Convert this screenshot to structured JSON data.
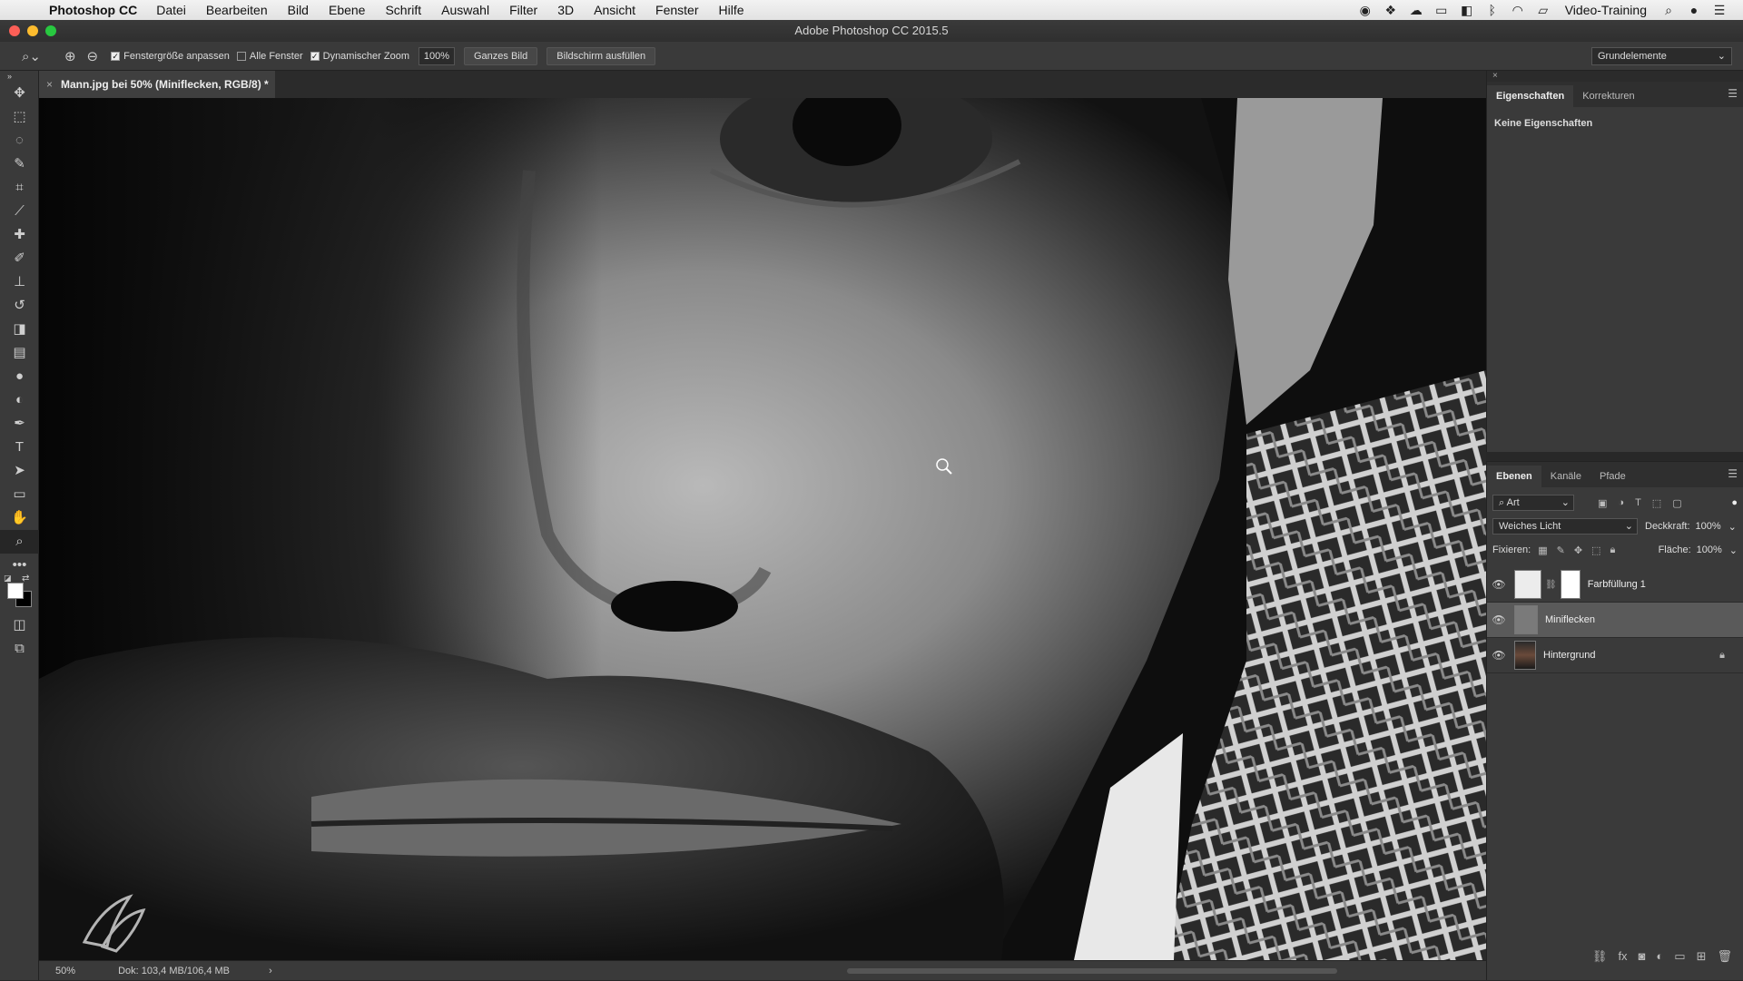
{
  "mac_menubar": {
    "app": "Photoshop CC",
    "items": [
      "Datei",
      "Bearbeiten",
      "Bild",
      "Ebene",
      "Schrift",
      "Auswahl",
      "Filter",
      "3D",
      "Ansicht",
      "Fenster",
      "Hilfe"
    ],
    "user": "Video-Training"
  },
  "window": {
    "title": "Adobe Photoshop CC 2015.5"
  },
  "options_bar": {
    "fit_window": "Fenstergröße anpassen",
    "all_windows": "Alle Fenster",
    "scrubby_zoom": "Dynamischer Zoom",
    "zoom_value": "100%",
    "fit_screen": "Ganzes Bild",
    "fill_screen": "Bildschirm ausfüllen",
    "workspace": "Grundelemente"
  },
  "document": {
    "tab_title": "Mann.jpg bei 50% (Miniflecken, RGB/8) *",
    "zoom": "50%",
    "doc_size": "Dok: 103,4 MB/106,4 MB"
  },
  "properties_panel": {
    "tabs": [
      "Eigenschaften",
      "Korrekturen"
    ],
    "empty_text": "Keine Eigenschaften"
  },
  "layers_panel": {
    "tabs": [
      "Ebenen",
      "Kanäle",
      "Pfade"
    ],
    "filter_kind": "Art",
    "blend_mode": "Weiches Licht",
    "opacity_label": "Deckkraft:",
    "opacity_value": "100%",
    "lock_label": "Fixieren:",
    "fill_label": "Fläche:",
    "fill_value": "100%",
    "layers": [
      {
        "name": "Farbfüllung 1"
      },
      {
        "name": "Miniflecken"
      },
      {
        "name": "Hintergrund"
      }
    ]
  },
  "colors": {
    "foreground": "#ffffff",
    "background": "#000000"
  }
}
